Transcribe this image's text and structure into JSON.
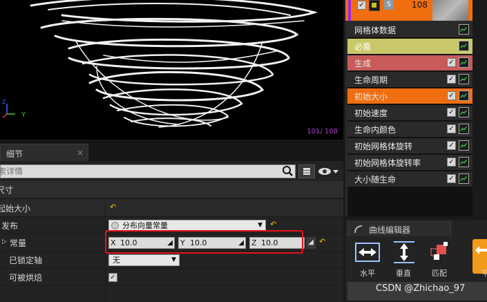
{
  "viewport": {
    "particle_count": "101/ 108",
    "axis_y": "Y"
  },
  "emitter": {
    "count": "108"
  },
  "details": {
    "tab_label": "细节",
    "close": "×",
    "search_placeholder": "索详情",
    "section": "尺寸",
    "module_name": "起始大小",
    "props": [
      {
        "label": "发布",
        "value": "分布向量常量"
      },
      {
        "label": "常量",
        "x_label": "X",
        "x": "10.0",
        "y_label": "Y",
        "y": "10.0",
        "z_label": "Z",
        "z": "10.0"
      },
      {
        "label": "已锁定轴",
        "value": "无"
      },
      {
        "label": "可被烘焙",
        "checked": true
      }
    ]
  },
  "modules": [
    {
      "name": "网格体数据",
      "color": "#2a2a2a",
      "check": false
    },
    {
      "name": "必需",
      "color": "#c8c86a",
      "check": false
    },
    {
      "name": "生成",
      "color": "#c85a5a",
      "check": true
    },
    {
      "name": "生命周期",
      "color": "#2a2a2a",
      "check": true
    },
    {
      "name": "初始大小",
      "color": "#f06e10",
      "check": true
    },
    {
      "name": "初始速度",
      "color": "#2a2a2a",
      "check": true
    },
    {
      "name": "生命内颜色",
      "color": "#2a2a2a",
      "check": true
    },
    {
      "name": "初始网格体旋转",
      "color": "#2a2a2a",
      "check": true
    },
    {
      "name": "初始网格体旋转率",
      "color": "#2a2a2a",
      "check": true
    },
    {
      "name": "大小随生命",
      "color": "#2a2a2a",
      "check": true
    }
  ],
  "curve_editor": {
    "tab_label": "曲线编辑器",
    "buttons": [
      "水平",
      "垂直",
      "匹配",
      "平"
    ]
  },
  "watermark": "CSDN @Zhichao_97"
}
